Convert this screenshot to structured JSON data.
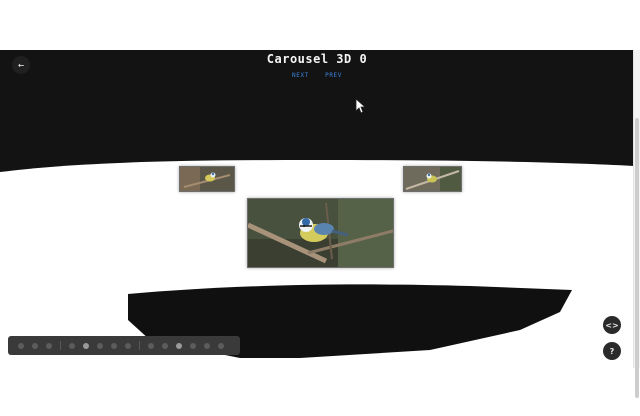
{
  "page": {
    "title": "Carousel 3D 0",
    "nav": {
      "next_label": "NEXT",
      "prev_label": "PREV"
    },
    "back_icon": "arrow-left-icon"
  },
  "colors": {
    "stage_background": "#131313",
    "nav_link": "#3a82d9",
    "title_text": "#f5f5f5"
  },
  "carousel": {
    "image_subject": "blue tit perched on a branch",
    "cards": [
      "left-back",
      "right-back",
      "front-center"
    ]
  },
  "toolbar": {
    "icons": [
      "tool-icon",
      "tool-icon",
      "tool-icon",
      "tool-icon",
      "tool-icon",
      "tool-icon",
      "tool-icon",
      "tool-icon",
      "tool-icon",
      "tool-icon",
      "tool-icon",
      "tool-icon",
      "tool-icon",
      "tool-icon",
      "tool-icon",
      "tool-icon",
      "tool-icon"
    ]
  },
  "floating_buttons": {
    "code_label": "<>",
    "help_label": "?"
  }
}
